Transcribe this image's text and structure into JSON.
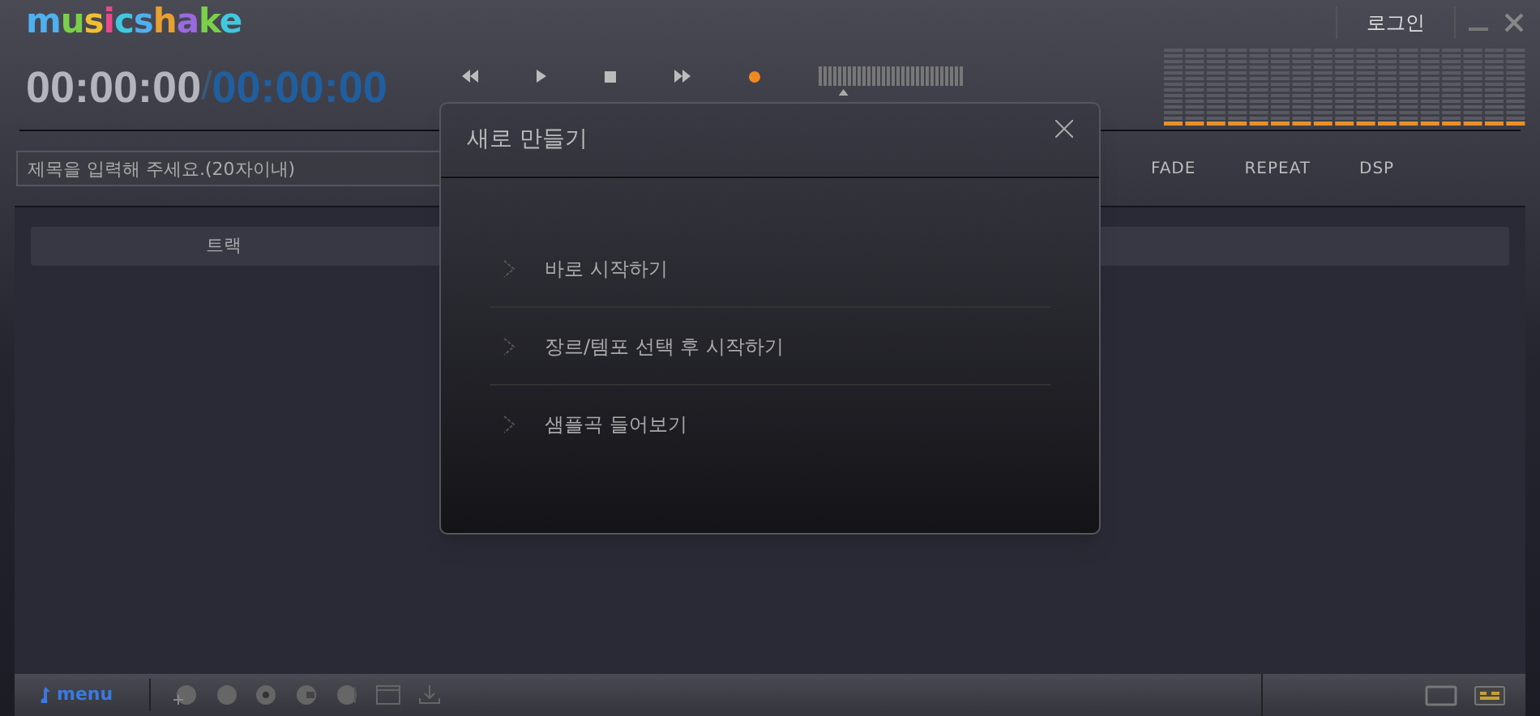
{
  "app": {
    "logo": "musicshake",
    "login": "로그인"
  },
  "timer": {
    "elapsed": "00:00:00",
    "separator": "/",
    "total": "00:00:00"
  },
  "transport": {
    "recording": true
  },
  "volume": {
    "level": 0.17
  },
  "title_field": {
    "placeholder": "제목을 입력해 주세요.(20자이내)"
  },
  "options": [
    "FADE",
    "REPEAT",
    "DSP"
  ],
  "track_table": {
    "columns": [
      "트랙"
    ]
  },
  "dialog": {
    "title": "새로 만들기",
    "items": [
      {
        "label": "바로 시작하기"
      },
      {
        "label": "장르/템포 선택 후 시작하기"
      },
      {
        "label": "샘플곡 들어보기"
      }
    ]
  },
  "bottom_bar": {
    "menu": "menu"
  }
}
